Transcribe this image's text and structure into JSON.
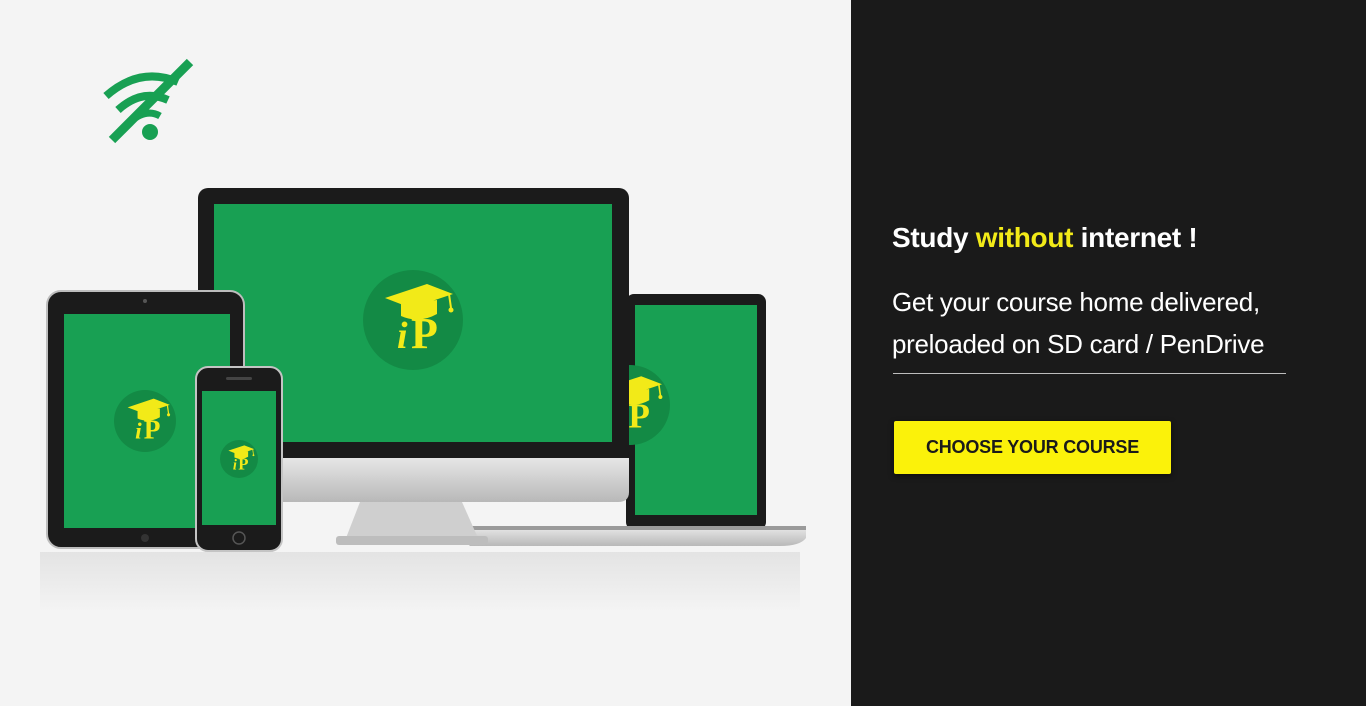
{
  "colors": {
    "brand_green": "#18a053",
    "accent_yellow": "#fbf20a",
    "headline_highlight": "#f2ea18",
    "dark_panel": "#1a1a1a",
    "light_panel": "#f4f4f4"
  },
  "icons": {
    "offline": "wifi-off-icon",
    "app_logo": "ip-graduation-cap-logo"
  },
  "hero": {
    "headline_pre": "Study ",
    "headline_highlight": "without",
    "headline_post": " internet !",
    "subtitle_line1": "Get your course home delivered,",
    "subtitle_line2": "preloaded on SD card / PenDrive",
    "cta_label": "CHOOSE YOUR COURSE"
  }
}
